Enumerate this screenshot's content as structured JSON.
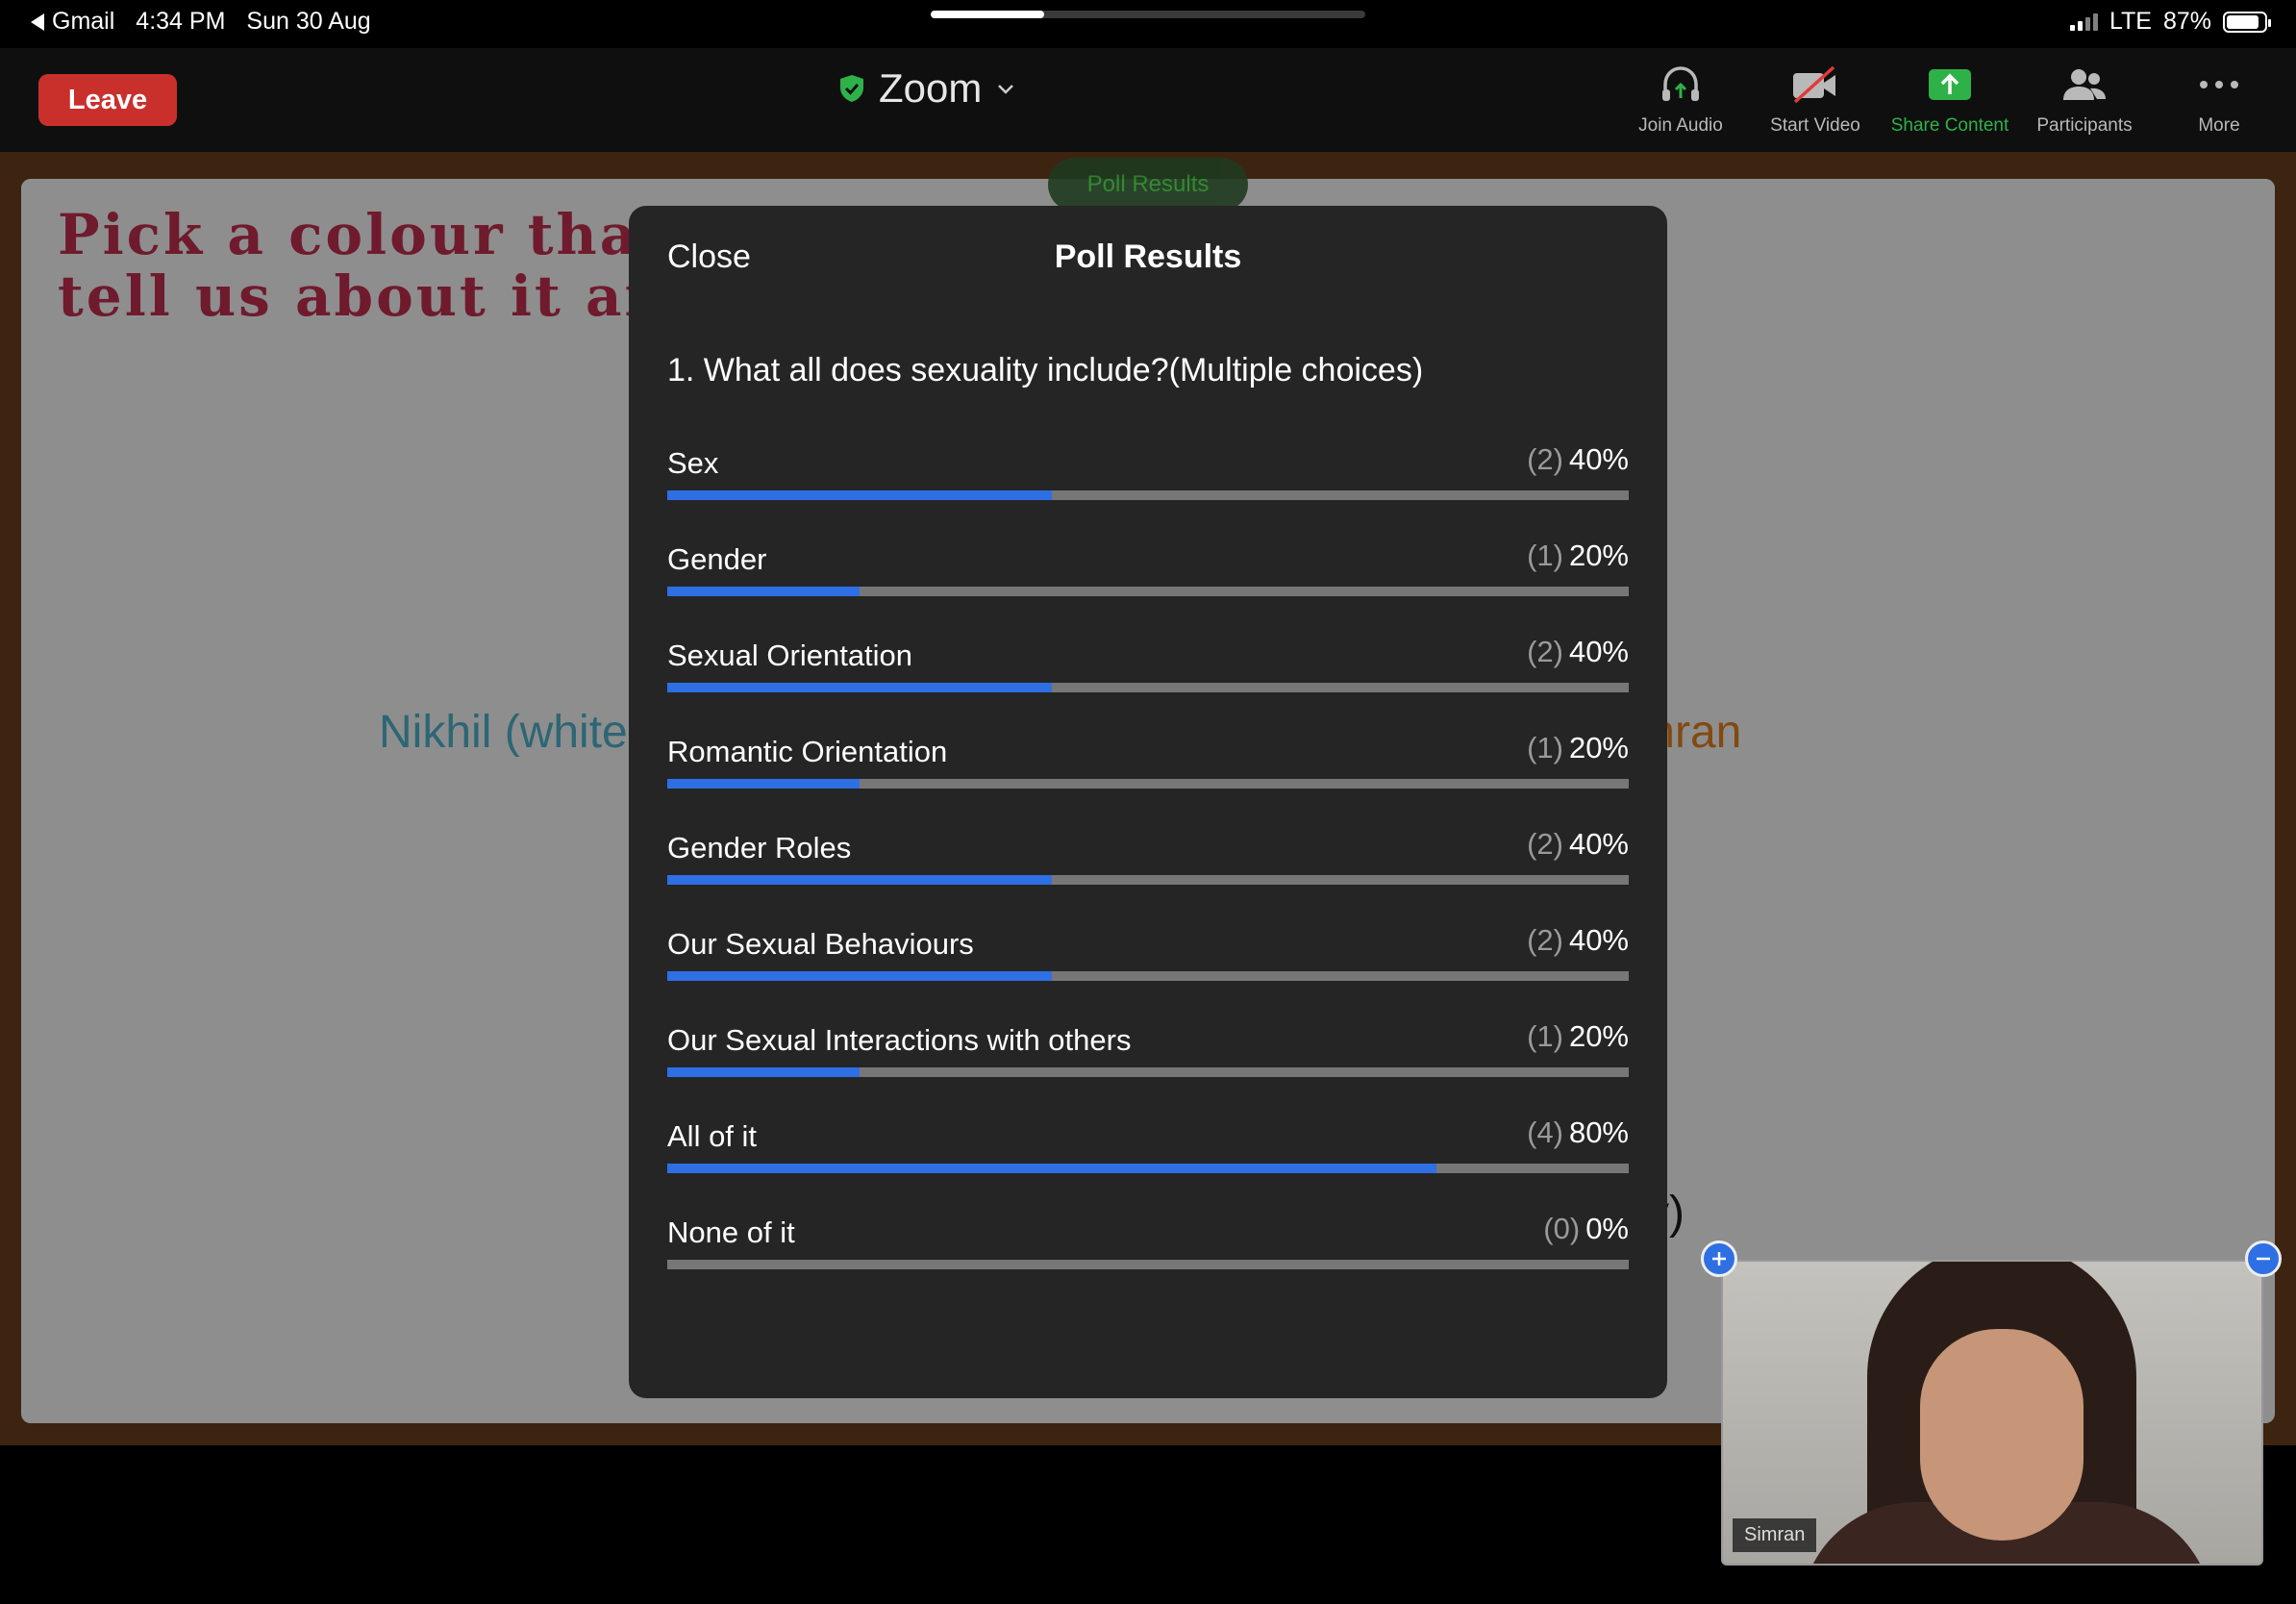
{
  "status_bar": {
    "back_app": "Gmail",
    "time": "4:34 PM",
    "date": "Sun 30 Aug",
    "network": "LTE",
    "battery": "87%"
  },
  "toolbar": {
    "leave_label": "Leave",
    "app_title": "Zoom",
    "join_audio": "Join Audio",
    "start_video": "Start Video",
    "share_content": "Share Content",
    "participants": "Participants",
    "more": "More"
  },
  "slide": {
    "heading_line1": "Pick a colour that",
    "heading_line2": "tell us about it and",
    "nikhil_text": "Nikhil (white",
    "simran_text": "mran",
    "fragment_text": "y)"
  },
  "poll_pill": "Poll Results",
  "modal": {
    "close_label": "Close",
    "title": "Poll Results",
    "question": "1. What all does sexuality include?(Multiple choices)",
    "options": [
      {
        "label": "Sex",
        "count": "(2)",
        "percent": "40%",
        "fraction": 0.4
      },
      {
        "label": "Gender",
        "count": "(1)",
        "percent": "20%",
        "fraction": 0.2
      },
      {
        "label": "Sexual Orientation",
        "count": "(2)",
        "percent": "40%",
        "fraction": 0.4
      },
      {
        "label": "Romantic Orientation",
        "count": "(1)",
        "percent": "20%",
        "fraction": 0.2
      },
      {
        "label": "Gender Roles",
        "count": "(2)",
        "percent": "40%",
        "fraction": 0.4
      },
      {
        "label": "Our Sexual Behaviours",
        "count": "(2)",
        "percent": "40%",
        "fraction": 0.4
      },
      {
        "label": "Our Sexual Interactions with others",
        "count": "(1)",
        "percent": "20%",
        "fraction": 0.2
      },
      {
        "label": "All of it",
        "count": "(4)",
        "percent": "80%",
        "fraction": 0.8
      },
      {
        "label": "None of it",
        "count": "(0)",
        "percent": "0%",
        "fraction": 0.0
      }
    ]
  },
  "video": {
    "participant_name": "Simran"
  },
  "colors": {
    "leave_red": "#c9302c",
    "bar_blue": "#2f6fe4",
    "share_green": "#2fb14a",
    "modal_bg": "#252526"
  }
}
